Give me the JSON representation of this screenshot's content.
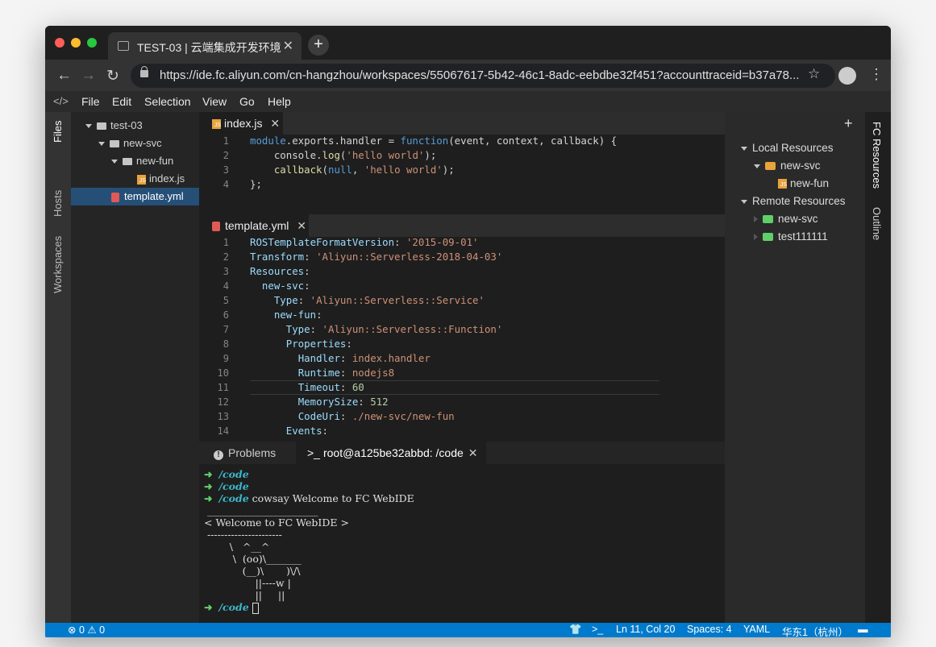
{
  "browser": {
    "tab_title": "TEST-03 | 云端集成开发环境",
    "url": "https://ide.fc.aliyun.com/cn-hangzhou/workspaces/55067617-5b42-46c1-8adc-eebdbe32f451?accounttraceid=b37a78..."
  },
  "menu": [
    "File",
    "Edit",
    "Selection",
    "View",
    "Go",
    "Help"
  ],
  "activity_tabs": [
    "Files",
    "Hosts",
    "Workspaces"
  ],
  "explorer": [
    {
      "label": "test-03",
      "type": "folder"
    },
    {
      "label": "new-svc",
      "type": "folder"
    },
    {
      "label": "new-fun",
      "type": "folder"
    },
    {
      "label": "index.js",
      "type": "js"
    },
    {
      "label": "template.yml",
      "type": "yml",
      "selected": true
    }
  ],
  "editor1": {
    "tab": "index.js",
    "lines": [
      "1",
      "2",
      "3",
      "4"
    ]
  },
  "editor2": {
    "tab": "template.yml",
    "lines": [
      "1",
      "2",
      "3",
      "4",
      "5",
      "6",
      "7",
      "8",
      "9",
      "10",
      "11",
      "12",
      "13",
      "14"
    ]
  },
  "panel": {
    "problems_tab": "Problems",
    "terminal_tab": "root@a125be32abbd: /code"
  },
  "terminal": {
    "prompt": "/code",
    "command": "cowsay Welcome to FC WebIDE",
    "cow": [
      " ______________________",
      "< Welcome to FC WebIDE >",
      " ----------------------",
      "        \\   ^__^",
      "         \\  (oo)\\_______",
      "            (__)\\       )\\/\\",
      "                ||----w |",
      "                ||     ||"
    ]
  },
  "fc_resources": {
    "local_title": "Local Resources",
    "local_service": "new-svc",
    "local_function": "new-fun",
    "remote_title": "Remote Resources",
    "remote_services": [
      "new-svc",
      "test111111"
    ]
  },
  "right_tabs": [
    "FC Resources",
    "Outline"
  ],
  "status": {
    "errors": "0",
    "warnings": "0",
    "position": "Ln 11, Col 20",
    "spaces": "Spaces: 4",
    "language": "YAML",
    "region": "华东1（杭州）"
  },
  "colors": {
    "status_bar": "#007acc",
    "accent_orange": "#e8a33d",
    "accent_green": "#5fd068"
  }
}
